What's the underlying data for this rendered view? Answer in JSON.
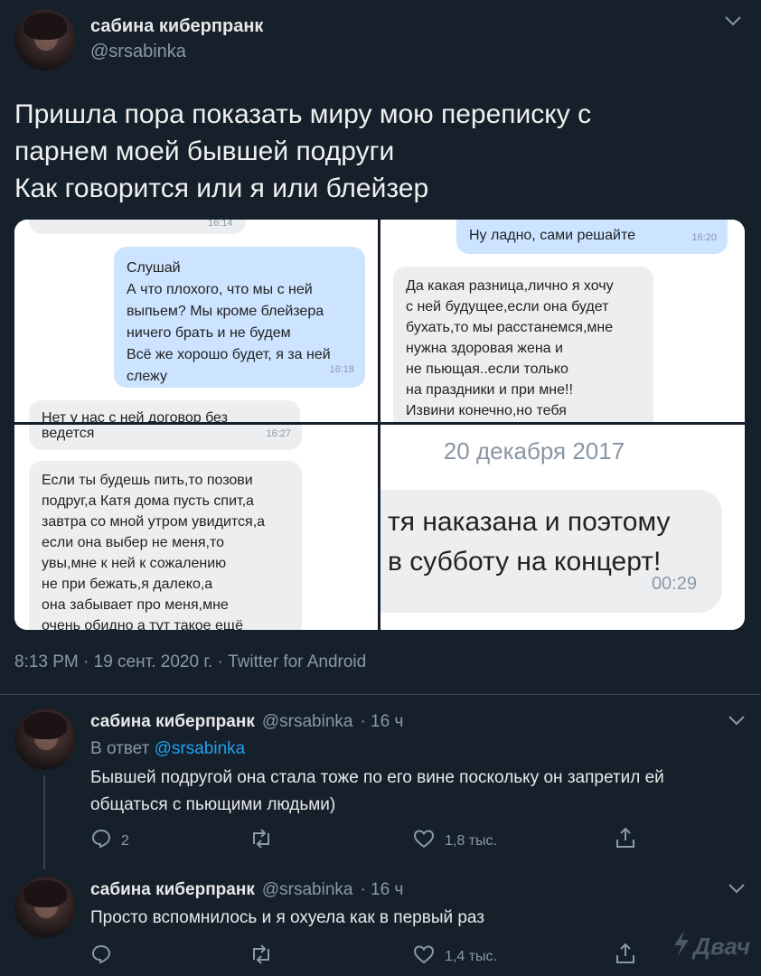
{
  "tweet": {
    "author_name": "сабина киберпранк",
    "author_handle": "@srsabinka",
    "text_lines": [
      "Пришла пора показать миру мою переписку с",
      "парнем моей бывшей подруги",
      "Как говорится или я или блейзер"
    ],
    "meta": "8:13 PM · 19 сент. 2020 г. · Twitter for Android"
  },
  "screenshots": {
    "top_left": {
      "top_time": "16:14",
      "outgoing": [
        "Слушай",
        "А что плохого, что мы с ней",
        "выпьем? Мы кроме блейзера",
        "ничего брать и не будем",
        "Всё же хорошо будет, я за ней",
        "слежу"
      ],
      "outgoing_time": "16:18",
      "cut_text": "Нет у нас с ней договор без"
    },
    "top_right": {
      "outgoing": [
        "Ну ладно, сами решайте"
      ],
      "outgoing_time": "16:20",
      "incoming": [
        "Да какая разница,лично я хочу",
        "с ней будущее,если она будет",
        "бухать,то мы расстанемся,мне",
        "нужна здоровая жена и",
        "не пьющая..если только",
        "на праздники и при мне!!",
        "Извини конечно,но тебя"
      ]
    },
    "bottom_left": {
      "top_line": "ведется",
      "top_time": "16:27",
      "incoming": [
        "Если ты будешь пить,то позови",
        "подруг,а Катя дома пусть спит,а",
        "завтра со мной утром увидится,а",
        "если она выбер не меня,то",
        "увы,мне к ней к сожалению",
        "не при бежать,я далеко,а",
        "она забывает про меня,мне",
        "очень обидно а тут такое ещё"
      ]
    },
    "bottom_right": {
      "date": "20 декабря 2017",
      "incoming": [
        "тя наказана и поэтому",
        "в субботу на концерт!"
      ],
      "time": "00:29"
    }
  },
  "replies": [
    {
      "author_name": "сабина киберпранк",
      "author_handle": "@srsabinka",
      "age": "· 16 ч",
      "reply_to_prefix": "В ответ",
      "reply_to_handle": "@srsabinka",
      "text_lines": [
        "Бывшей подругой она стала тоже по его вине поскольку он запретил ей",
        "общаться с пьющими людьми)"
      ],
      "reply_count": "2",
      "retweet_count": "",
      "like_count": "1,8 тыс."
    },
    {
      "author_name": "сабина киберпранк",
      "author_handle": "@srsabinka",
      "age": "· 16 ч",
      "text_lines": [
        "Просто вспомнилось и я охуела как в первый раз"
      ],
      "reply_count": "",
      "retweet_count": "",
      "like_count": "1,4 тыс."
    }
  ],
  "watermark": "Двач",
  "icons": [
    "avatar",
    "chevron-down-icon",
    "reply-icon",
    "retweet-icon",
    "like-icon",
    "share-icon",
    "bolt-icon"
  ]
}
